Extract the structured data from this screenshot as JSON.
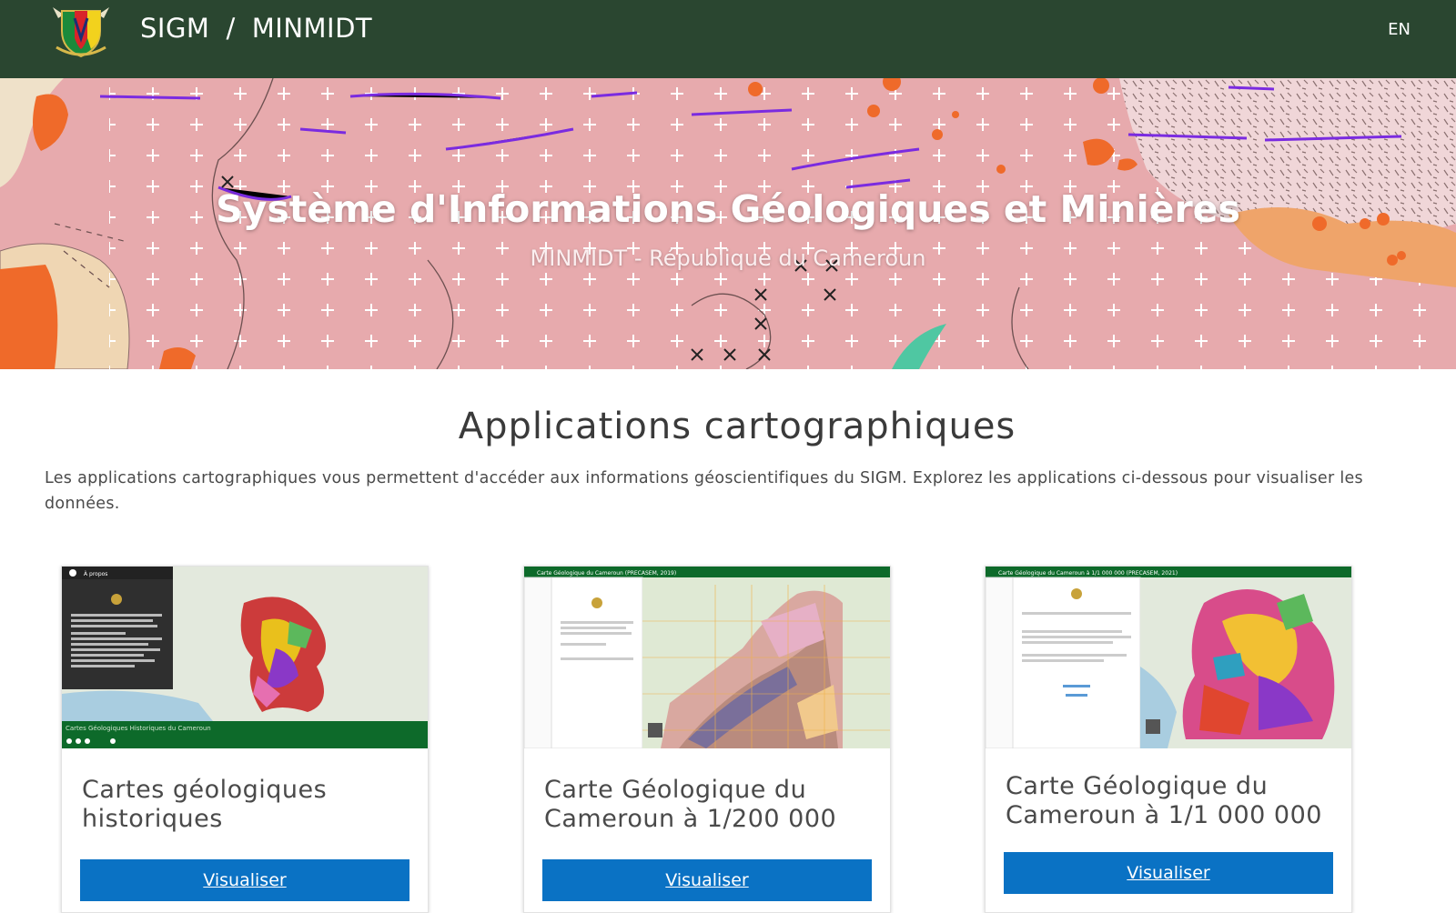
{
  "header": {
    "brand_left": "SIGM",
    "separator": "/",
    "brand_right": "MINMIDT",
    "language": "EN",
    "background": "#2a4630"
  },
  "hero": {
    "title": "Système d'Informations Géologiques et Minières",
    "subtitle": "MINMIDT - République du Cameroun"
  },
  "section": {
    "title": "Applications cartographiques",
    "description": "Les applications cartographiques vous permettent d'accéder aux informations géoscientifiques du SIGM. Explorez les applications ci-dessous pour visualiser les données."
  },
  "cards": [
    {
      "title": "Cartes géologiques historiques",
      "button": "Visualiser",
      "thumb_panel_title": "À propos",
      "thumb_footer": "Cartes Géologiques Historiques du Cameroun"
    },
    {
      "title": "Carte Géologique du Cameroun à 1/200 000",
      "button": "Visualiser",
      "thumb_header": "Carte Géologique du Cameroun (PRECASEM, 2019)"
    },
    {
      "title": "Carte Géologique du Cameroun à 1/1 000 000",
      "button": "Visualiser",
      "thumb_header": "Carte Géologique du Cameroun à 1/1 000 000 (PRECASEM, 2021)"
    }
  ],
  "colors": {
    "button": "#0a72c4",
    "hero_base": "#e7aaad",
    "accent_orange": "#ef6a2a",
    "dike_purple": "#7a2be0"
  }
}
